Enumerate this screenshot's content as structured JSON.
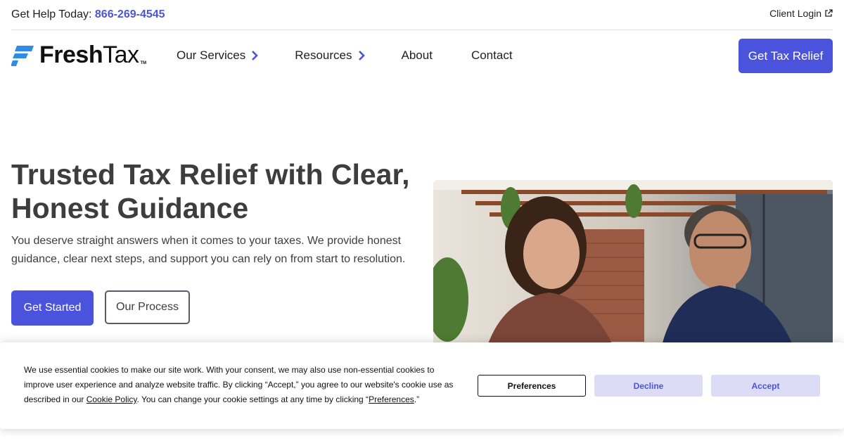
{
  "topbar": {
    "help_label": "Get Help Today:",
    "phone": "866-269-4545",
    "client_login": "Client Login"
  },
  "nav": {
    "logo_fresh": "Fresh",
    "logo_tax": "Tax",
    "logo_tm": "TM",
    "items": [
      {
        "label": "Our Services"
      },
      {
        "label": "Resources"
      },
      {
        "label": "About"
      },
      {
        "label": "Contact"
      }
    ],
    "cta": "Get Tax Relief"
  },
  "hero": {
    "title": "Trusted Tax Relief with Clear, Honest Guidance",
    "subtitle": "You deserve straight answers when it comes to your taxes. We provide honest guidance, clear next steps, and support you can rely on from start to resolution.",
    "primary_button": "Get Started",
    "secondary_button": "Our Process"
  },
  "cookie": {
    "text_1": "We use essential cookies to make our site work. With your consent, we may also use non-essential cookies to improve user experience and analyze website traffic. By clicking “Accept,” you agree to our website's cookie use as described in our ",
    "cookie_policy_link": "Cookie Policy",
    "text_2": ". You can change your cookie settings at any time by clicking “",
    "preferences_link": "Preferences",
    "text_3": ".”",
    "preferences_button": "Preferences",
    "decline_button": "Decline",
    "accept_button": "Accept"
  },
  "colors": {
    "accent": "#4b53dc",
    "logo_blue": "#2f8be6",
    "soft_button": "#dcdcf6"
  }
}
